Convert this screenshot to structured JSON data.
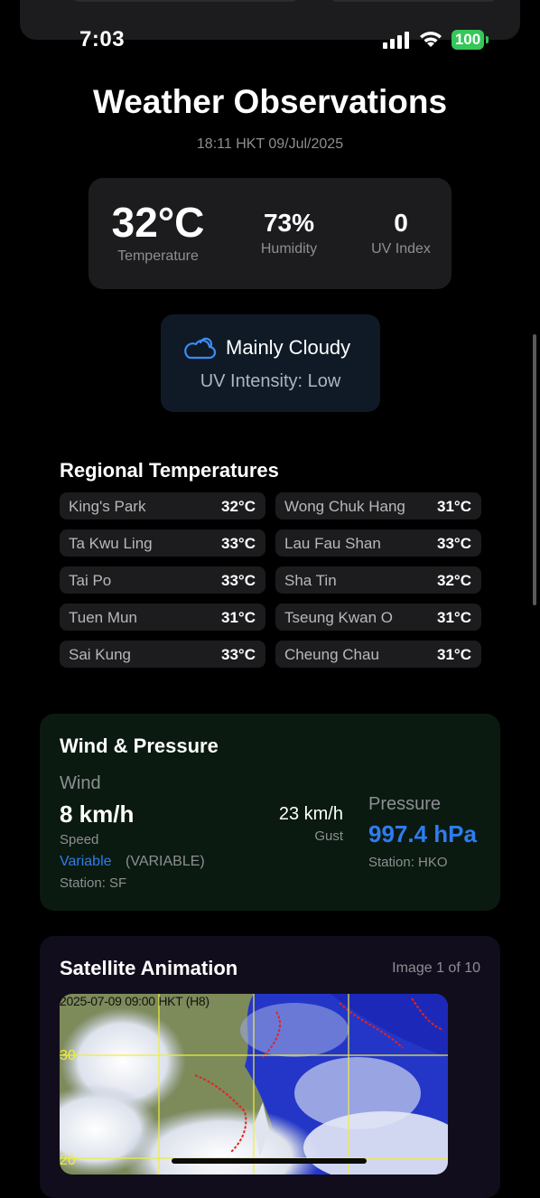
{
  "status_bar": {
    "time": "7:03",
    "battery": "100"
  },
  "header": {
    "title": "Weather Observations",
    "timestamp": "18:11 HKT 09/Jul/2025"
  },
  "observations": {
    "temperature": {
      "value": "32°C",
      "label": "Temperature"
    },
    "humidity": {
      "value": "73%",
      "label": "Humidity"
    },
    "uv": {
      "value": "0",
      "label": "UV Index"
    }
  },
  "condition": {
    "icon": "cloud-icon",
    "text": "Mainly Cloudy",
    "uv_intensity": "UV Intensity: Low"
  },
  "regional": {
    "title": "Regional Temperatures",
    "items": [
      {
        "name": "King's Park",
        "temp": "32°C"
      },
      {
        "name": "Wong Chuk Hang",
        "temp": "31°C"
      },
      {
        "name": "Ta Kwu Ling",
        "temp": "33°C"
      },
      {
        "name": "Lau Fau Shan",
        "temp": "33°C"
      },
      {
        "name": "Tai Po",
        "temp": "33°C"
      },
      {
        "name": "Sha Tin",
        "temp": "32°C"
      },
      {
        "name": "Tuen Mun",
        "temp": "31°C"
      },
      {
        "name": "Tseung Kwan O",
        "temp": "31°C"
      },
      {
        "name": "Sai Kung",
        "temp": "33°C"
      },
      {
        "name": "Cheung Chau",
        "temp": "31°C"
      }
    ]
  },
  "wind": {
    "title": "Wind & Pressure",
    "wind_label": "Wind",
    "speed": "8 km/h",
    "speed_label": "Speed",
    "gust": "23 km/h",
    "gust_label": "Gust",
    "direction": "Variable",
    "direction_code": "(VARIABLE)",
    "station": "Station: SF",
    "pressure_label": "Pressure",
    "pressure": "997.4 hPa",
    "pressure_station": "Station: HKO"
  },
  "satellite": {
    "title": "Satellite Animation",
    "counter": "Image 1 of 10",
    "caption": "2025-07-09 09:00 HKT (H8)",
    "lat_30": "30",
    "lat_20": "20"
  },
  "colors": {
    "accent_blue": "#2f7cf0",
    "battery_green": "#35c759",
    "card": "#1c1c1e"
  }
}
